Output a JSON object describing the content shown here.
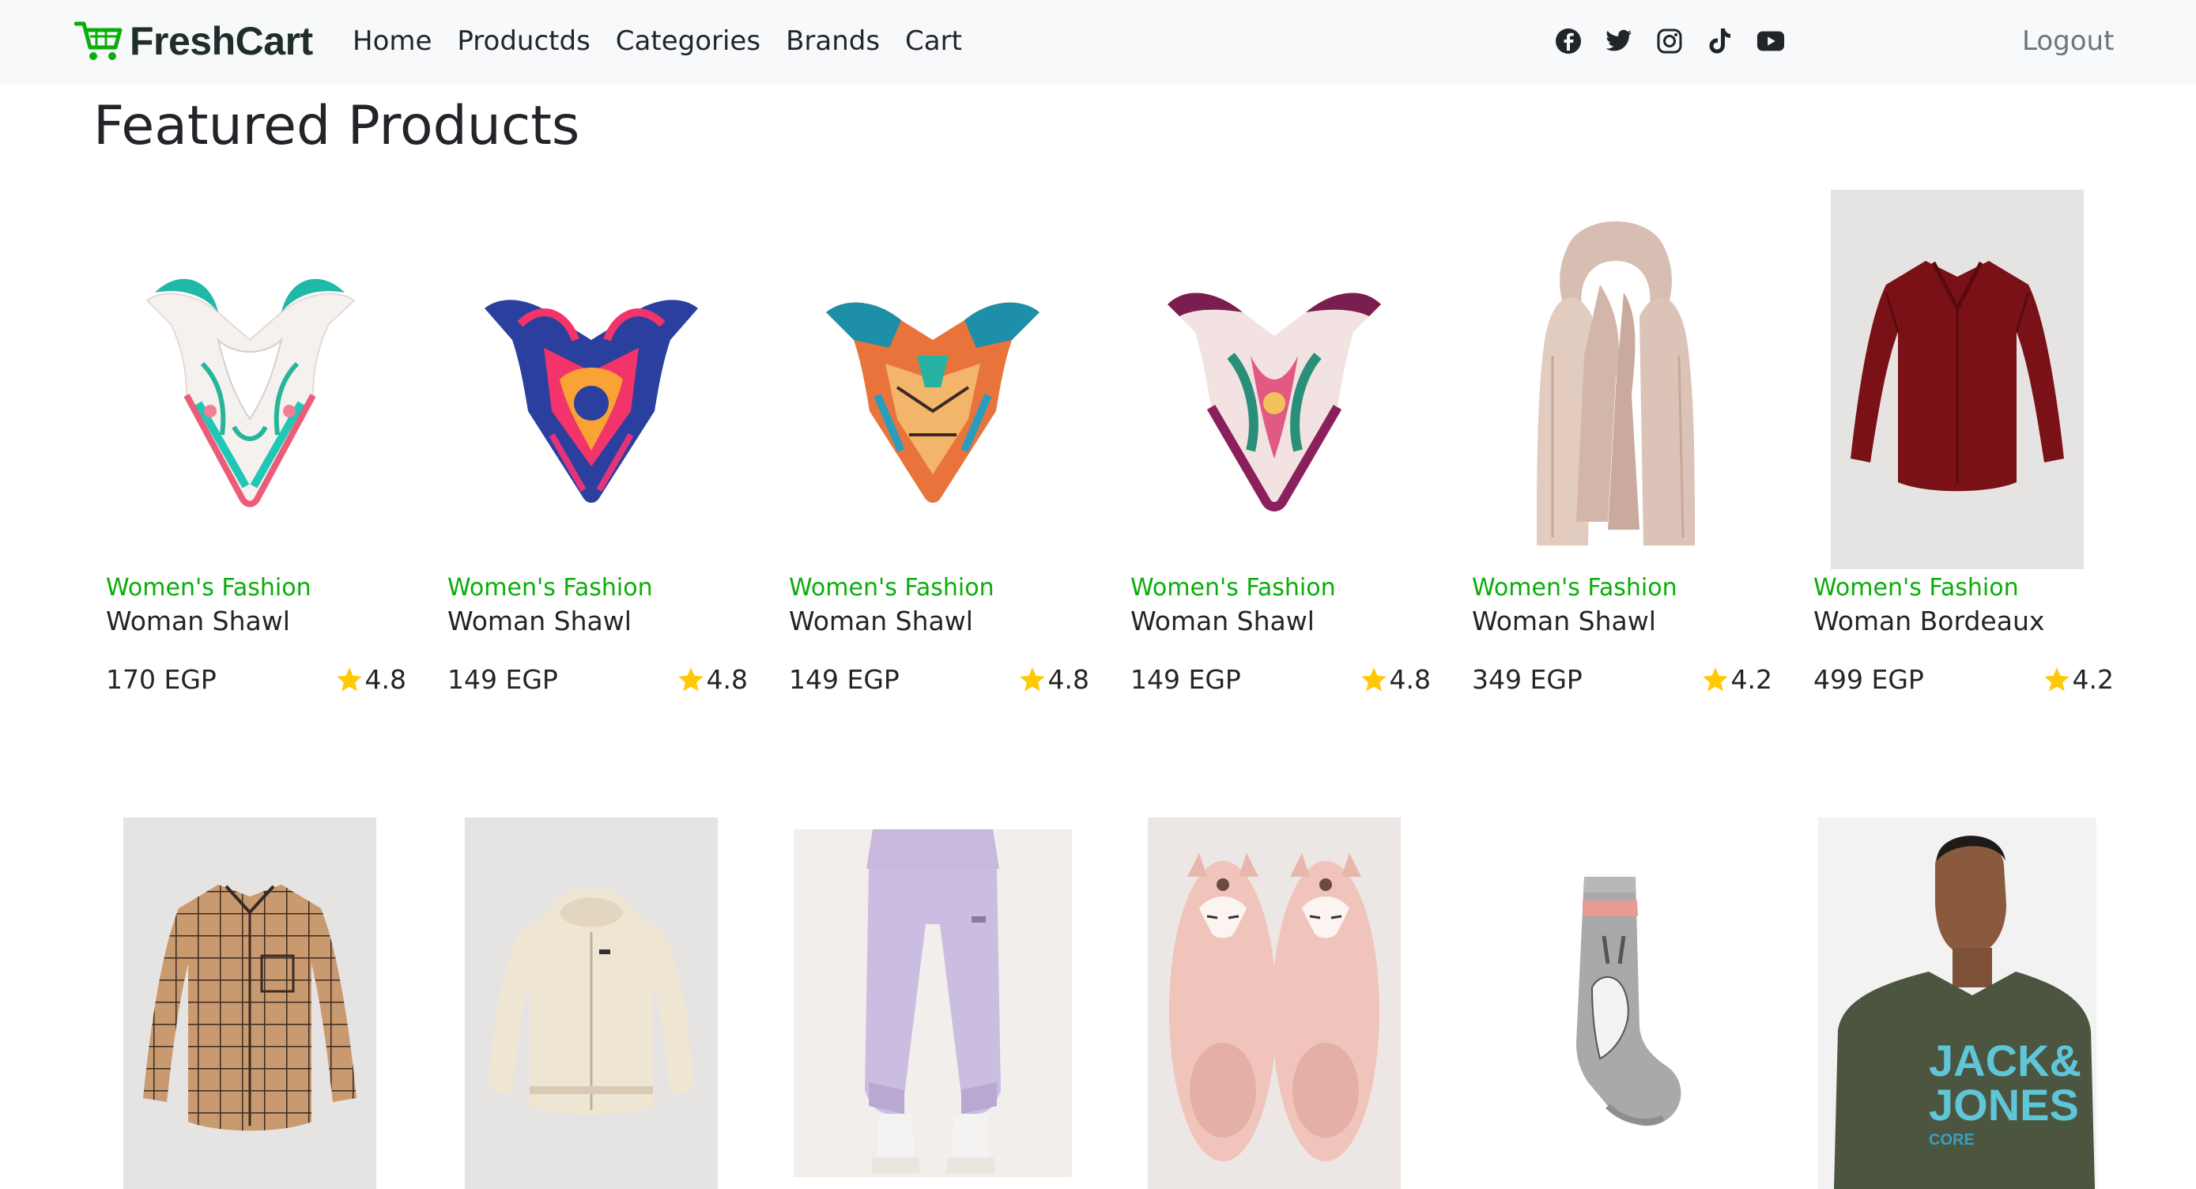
{
  "brand": {
    "name": "FreshCart",
    "icon": "cart-icon",
    "color": "#0aad0a"
  },
  "nav": {
    "links": [
      "Home",
      "Productds",
      "Categories",
      "Brands",
      "Cart"
    ],
    "social_icons": [
      "facebook-icon",
      "twitter-icon",
      "instagram-icon",
      "tiktok-icon",
      "youtube-icon"
    ],
    "logout_label": "Logout"
  },
  "page": {
    "heading": "Featured Products"
  },
  "colors": {
    "accent": "#0aad0a",
    "star": "#ffc908",
    "navbar_bg": "#f8f9fa"
  },
  "products": [
    {
      "category": "Women's Fashion",
      "title": "Woman Shawl",
      "price": "170 EGP",
      "rating": "4.8",
      "image": "white-teal-floral-scarf"
    },
    {
      "category": "Women's Fashion",
      "title": "Woman Shawl",
      "price": "149 EGP",
      "rating": "4.8",
      "image": "blue-pink-floral-scarf"
    },
    {
      "category": "Women's Fashion",
      "title": "Woman Shawl",
      "price": "149 EGP",
      "rating": "4.8",
      "image": "orange-teal-geometric-scarf"
    },
    {
      "category": "Women's Fashion",
      "title": "Woman Shawl",
      "price": "149 EGP",
      "rating": "4.8",
      "image": "purple-floral-scarf"
    },
    {
      "category": "Women's Fashion",
      "title": "Woman Shawl",
      "price": "349 EGP",
      "rating": "4.2",
      "image": "beige-long-shawl"
    },
    {
      "category": "Women's Fashion",
      "title": "Woman Bordeaux",
      "price": "499 EGP",
      "rating": "4.2",
      "image": "bordeaux-blouse"
    }
  ],
  "products_row2": [
    {
      "image": "brown-plaid-shirt"
    },
    {
      "image": "cream-hoodie"
    },
    {
      "image": "lilac-sweatpants"
    },
    {
      "image": "pink-fuzzy-slippers"
    },
    {
      "image": "grey-bunny-sock"
    },
    {
      "image": "jack-jones-tshirt",
      "print_line1": "JACK&",
      "print_line2": "JONES",
      "print_line3": "CORE"
    }
  ]
}
